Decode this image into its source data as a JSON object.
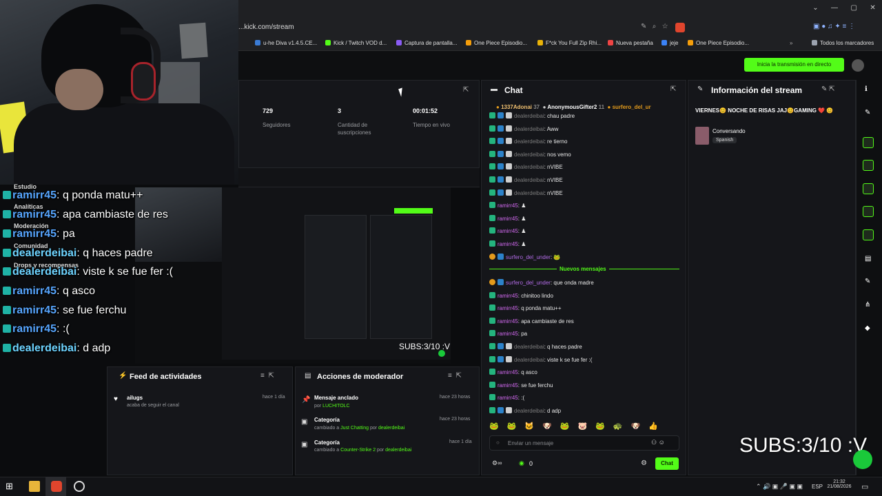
{
  "browser": {
    "url": "...kick.com/stream",
    "bookmarks": [
      "u-he Diva v1.4.5.CE...",
      "Kick / Twitch VOD d...",
      "Captura de pantalla...",
      "One Piece Episodio...",
      "F*ck You Full Zip Rhi...",
      "Nueva pestaña",
      "jeje",
      "One Piece Episodio...",
      "Todos los marcadores"
    ],
    "window_controls": [
      "⌄",
      "—",
      "▢",
      "✕"
    ]
  },
  "header": {
    "live_button": "Inicia la transmisión en directo"
  },
  "stats": {
    "followers_value": "729",
    "followers_label": "Seguidores",
    "subs_value": "3",
    "subs_label": "Cantidad de suscripciones",
    "uptime_value": "00:01:52",
    "uptime_label": "Tiempo en vivo"
  },
  "overlay_chat": [
    {
      "user": "ramirr45",
      "text": ": q ponda matu++",
      "mod": false
    },
    {
      "user": "ramirr45",
      "text": ": apa cambiaste de res",
      "mod": false
    },
    {
      "user": "ramirr45",
      "text": ": pa",
      "mod": false
    },
    {
      "user": "dealerdeibai",
      "text": ": q haces padre",
      "mod": true
    },
    {
      "user": "dealerdeibai",
      "text": ": viste k se fue fer :(",
      "mod": true
    },
    {
      "user": "ramirr45",
      "text": ": q asco",
      "mod": false
    },
    {
      "user": "ramirr45",
      "text": ": se fue ferchu",
      "mod": false
    },
    {
      "user": "ramirr45",
      "text": ": :(",
      "mod": false
    },
    {
      "user": "dealerdeibai",
      "text": ": d adp",
      "mod": true
    }
  ],
  "sidebar_sections": [
    "Estudio",
    "Analíticas",
    "Moderación",
    "Comunidad",
    "Drops y recompensas"
  ],
  "preview": {
    "subs_overlay": "SUBS:3/10 :V"
  },
  "feed": {
    "title": "Feed de actividades",
    "items": [
      {
        "user": "ailugs",
        "desc": "acaba de seguir el canal",
        "time": "hace 1 día"
      }
    ]
  },
  "mod_actions": {
    "title": "Acciones de moderador",
    "items": [
      {
        "title": "Mensaje anclado",
        "desc_prefix": "por ",
        "desc_user": "LUCHITOLC",
        "time": "hace 23 horas"
      },
      {
        "title": "Categoría",
        "desc_prefix": "cambiado a ",
        "desc_cat": "Just Chatting",
        "desc_mid": " por ",
        "desc_user": "dealerdeibai",
        "time": "hace 23 horas"
      },
      {
        "title": "Categoría",
        "desc_prefix": "cambiado a ",
        "desc_cat": "Counter-Strike 2",
        "desc_mid": " por ",
        "desc_user": "dealerdeibai",
        "time": "hace 1 día"
      }
    ]
  },
  "chat": {
    "title": "Chat",
    "top_gifters": [
      "1337Adonai",
      "37",
      "AnonymousGifter2",
      "11",
      "surfero_del_ur"
    ],
    "messages": [
      {
        "user": "dealerdeibai",
        "text": ": chau padre",
        "type": "d"
      },
      {
        "user": "dealerdeibai",
        "text": ": Aww",
        "type": "d"
      },
      {
        "user": "dealerdeibai",
        "text": ": re tierno",
        "type": "d"
      },
      {
        "user": "dealerdeibai",
        "text": ": nos vemo",
        "type": "d"
      },
      {
        "user": "dealerdeibai",
        "text": ": nVIBE",
        "type": "d"
      },
      {
        "user": "dealerdeibai",
        "text": ": nVIBE",
        "type": "d"
      },
      {
        "user": "dealerdeibai",
        "text": ": nVIBE",
        "type": "d"
      },
      {
        "user": "ramirr45",
        "text": ": ♟",
        "type": "r"
      },
      {
        "user": "ramirr45",
        "text": ": ♟",
        "type": "r"
      },
      {
        "user": "ramirr45",
        "text": ": ♟",
        "type": "r"
      },
      {
        "user": "ramirr45",
        "text": ": ♟",
        "type": "r"
      },
      {
        "user": "surfero_del_under",
        "text": ": 🐸",
        "type": "s"
      }
    ],
    "new_messages_label": "Nuevos mensajes",
    "messages_new": [
      {
        "user": "surfero_del_under",
        "text": ": que onda madre",
        "type": "s"
      },
      {
        "user": "ramirr45",
        "text": ": chinitoo lindo",
        "type": "r"
      },
      {
        "user": "ramirr45",
        "text": ": q ponda matu++",
        "type": "r"
      },
      {
        "user": "ramirr45",
        "text": ": apa cambiaste de res",
        "type": "r"
      },
      {
        "user": "ramirr45",
        "text": ": pa",
        "type": "r"
      },
      {
        "user": "dealerdeibai",
        "text": ": q haces padre",
        "type": "d"
      },
      {
        "user": "dealerdeibai",
        "text": ": viste k se fue fer :(",
        "type": "d"
      },
      {
        "user": "ramirr45",
        "text": ": q asco",
        "type": "r"
      },
      {
        "user": "ramirr45",
        "text": ": se fue ferchu",
        "type": "r"
      },
      {
        "user": "ramirr45",
        "text": ": :(",
        "type": "r"
      },
      {
        "user": "dealerdeibai",
        "text": ": d adp",
        "type": "d"
      }
    ],
    "input_placeholder": "Enviar un mensaje",
    "viewers": "0",
    "send_button": "Chat"
  },
  "info": {
    "title": "Información del stream",
    "stream_title": "VIERNES😊 NOCHE DE RISAS JAJ😊GAMING ❤️ 😊",
    "category": "Conversando",
    "language": "Spanish"
  },
  "overlay_subs_big": "SUBS:3/10 :V",
  "taskbar": {
    "lang": "ESP",
    "time": "21:32",
    "date": "21/08/2026"
  },
  "colors": {
    "kick_green": "#53fc18",
    "panel_bg": "#15161a",
    "page_bg": "#0b0c0e"
  }
}
